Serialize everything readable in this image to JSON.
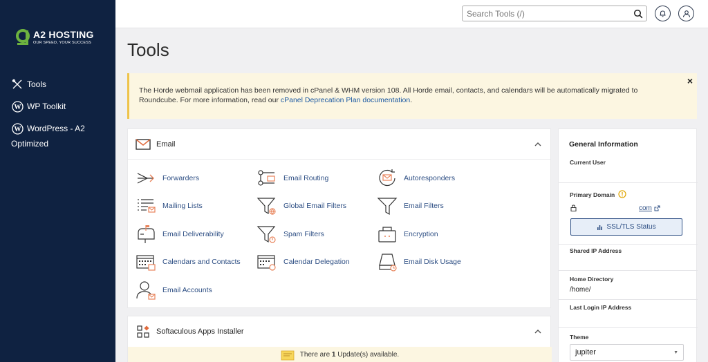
{
  "brand": {
    "name": "A2 HOSTING",
    "tagline": "OUR SPEED, YOUR SUCCESS",
    "accent": "#6db33f"
  },
  "sidebar": {
    "items": [
      {
        "label": "Tools",
        "icon": "tools-icon"
      },
      {
        "label": "WP Toolkit",
        "icon": "wordpress-icon"
      },
      {
        "label": "WordPress - A2",
        "label_cont": "Optimized",
        "icon": "wordpress-icon"
      }
    ]
  },
  "topbar": {
    "search_placeholder": "Search Tools (/)"
  },
  "page": {
    "title": "Tools"
  },
  "notice": {
    "text": "The Horde webmail application has been removed in cPanel & WHM version 108. All Horde email, contacts, and calendars will be automatically migrated to Roundcube. For more information, read our ",
    "link": "cPanel Deprecation Plan documentation",
    "suffix": ".",
    "close": "×"
  },
  "email_section": {
    "title": "Email",
    "tools": [
      {
        "label": "Forwarders",
        "icon": "forwarders-icon"
      },
      {
        "label": "Email Routing",
        "icon": "email-routing-icon"
      },
      {
        "label": "Autoresponders",
        "icon": "autoresponders-icon"
      },
      {
        "label": "Mailing Lists",
        "icon": "mailing-lists-icon"
      },
      {
        "label": "Global Email Filters",
        "icon": "global-email-filters-icon"
      },
      {
        "label": "Email Filters",
        "icon": "email-filters-icon"
      },
      {
        "label": "Email Deliverability",
        "icon": "mailbox-icon"
      },
      {
        "label": "Spam Filters",
        "icon": "spam-filters-icon"
      },
      {
        "label": "Encryption",
        "icon": "encryption-icon"
      },
      {
        "label": "Calendars and Contacts",
        "icon": "calendar-icon"
      },
      {
        "label": "Calendar Delegation",
        "icon": "calendar-delegation-icon"
      },
      {
        "label": "Email Disk Usage",
        "icon": "disk-usage-icon"
      },
      {
        "label": "Email Accounts",
        "icon": "email-accounts-icon"
      }
    ]
  },
  "softaculous": {
    "title": "Softaculous Apps Installer",
    "update_prefix": "There are ",
    "update_count": "1",
    "update_suffix": " Update(s) available."
  },
  "general_info": {
    "title": "General Information",
    "current_user_label": "Current User",
    "primary_domain_label": "Primary Domain",
    "domain_suffix": "com",
    "ssl_button": "SSL/TLS Status",
    "shared_ip_label": "Shared IP Address",
    "home_dir_label": "Home Directory",
    "home_dir_value": "/home/",
    "last_login_label": "Last Login IP Address",
    "theme_label": "Theme",
    "theme_value": "jupiter"
  },
  "colors": {
    "sidebar_bg": "#0f2241",
    "link": "#2e4f84",
    "notice_bg": "#fcf6e1",
    "icon_accent": "#e8835a"
  }
}
